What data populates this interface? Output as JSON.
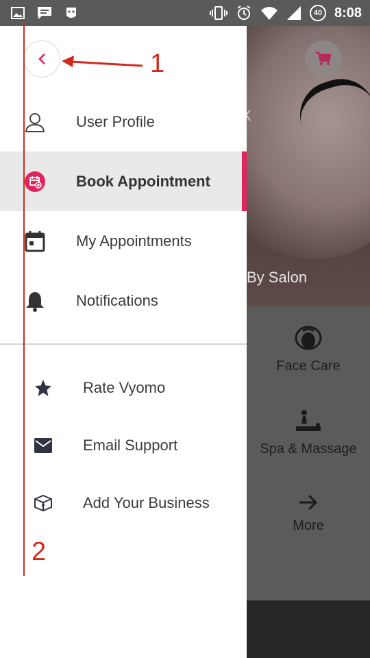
{
  "status_bar": {
    "time": "8:08",
    "badge": "40",
    "left_icons": [
      "image-icon",
      "message-icon",
      "face-icon"
    ],
    "right_icons": [
      "vibrate-icon",
      "alarm-icon",
      "wifi-icon",
      "signal-icon",
      "battery-icon"
    ]
  },
  "background": {
    "hero_partial_text": "X",
    "hero_caption": "By Salon",
    "categories": [
      {
        "label": "Face Care",
        "icon": "face-care-icon"
      },
      {
        "label": "Spa & Massage",
        "icon": "spa-massage-icon"
      },
      {
        "label": "More",
        "icon": "arrow-right-icon"
      }
    ]
  },
  "drawer": {
    "nav_items": [
      {
        "label": "User Profile",
        "icon": "user-profile-icon",
        "active": false
      },
      {
        "label": "Book Appointment",
        "icon": "book-appointment-icon",
        "active": true
      },
      {
        "label": "My Appointments",
        "icon": "calendar-icon",
        "active": false
      },
      {
        "label": "Notifications",
        "icon": "bell-icon",
        "active": false
      }
    ],
    "secondary_items": [
      {
        "label": "Rate Vyomo",
        "icon": "star-icon"
      },
      {
        "label": "Email Support",
        "icon": "mail-icon"
      },
      {
        "label": "Add Your Business",
        "icon": "business-icon"
      }
    ]
  },
  "annotations": {
    "label_1": "1",
    "label_2": "2"
  },
  "colors": {
    "accent": "#e0245e",
    "annotation": "#cf2a1c"
  }
}
